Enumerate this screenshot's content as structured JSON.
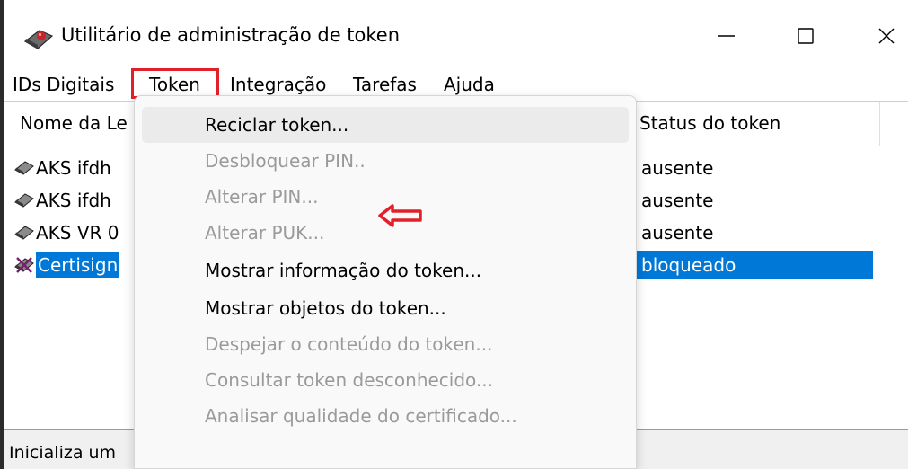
{
  "window": {
    "title": "Utilitário de administração de token",
    "controls": {
      "minimize": "—",
      "maximize": "☐",
      "close": "✕"
    }
  },
  "menubar": {
    "items": [
      "IDs Digitais",
      "Token",
      "Integração",
      "Tarefas",
      "Ajuda"
    ],
    "highlighted": "Token"
  },
  "list": {
    "columns": [
      "Nome da Le",
      "Status do token"
    ],
    "rows": [
      {
        "name": "AKS ifdh",
        "status": "ausente",
        "icon": "card-reader-icon"
      },
      {
        "name": "AKS ifdh",
        "status": "ausente",
        "icon": "card-reader-icon"
      },
      {
        "name": "AKS VR 0",
        "status": "ausente",
        "icon": "card-reader-icon"
      },
      {
        "name": "Certisign",
        "status": "bloqueado",
        "icon": "blocked-reader-icon",
        "selected": true
      }
    ]
  },
  "statusbar": {
    "text": "Inicializa um"
  },
  "dropdown": {
    "items": [
      {
        "label": "Reciclar token...",
        "enabled": true,
        "hover": true
      },
      {
        "label": "Desbloquear PIN..",
        "enabled": false
      },
      {
        "label": "Alterar PIN...",
        "enabled": false
      },
      {
        "label": "Alterar PUK...",
        "enabled": false
      },
      {
        "label": "Mostrar informação do token...",
        "enabled": true
      },
      {
        "label": "Mostrar objetos do token...",
        "enabled": true
      },
      {
        "label": "Despejar o conteúdo do token...",
        "enabled": false
      },
      {
        "label": "Consultar token desconhecido...",
        "enabled": false
      },
      {
        "label": "Analisar qualidade do certificado...",
        "enabled": false
      }
    ]
  },
  "colors": {
    "selection": "#0078d7",
    "annotation_red": "#e2202a",
    "disabled_text": "#9a9a9a"
  }
}
